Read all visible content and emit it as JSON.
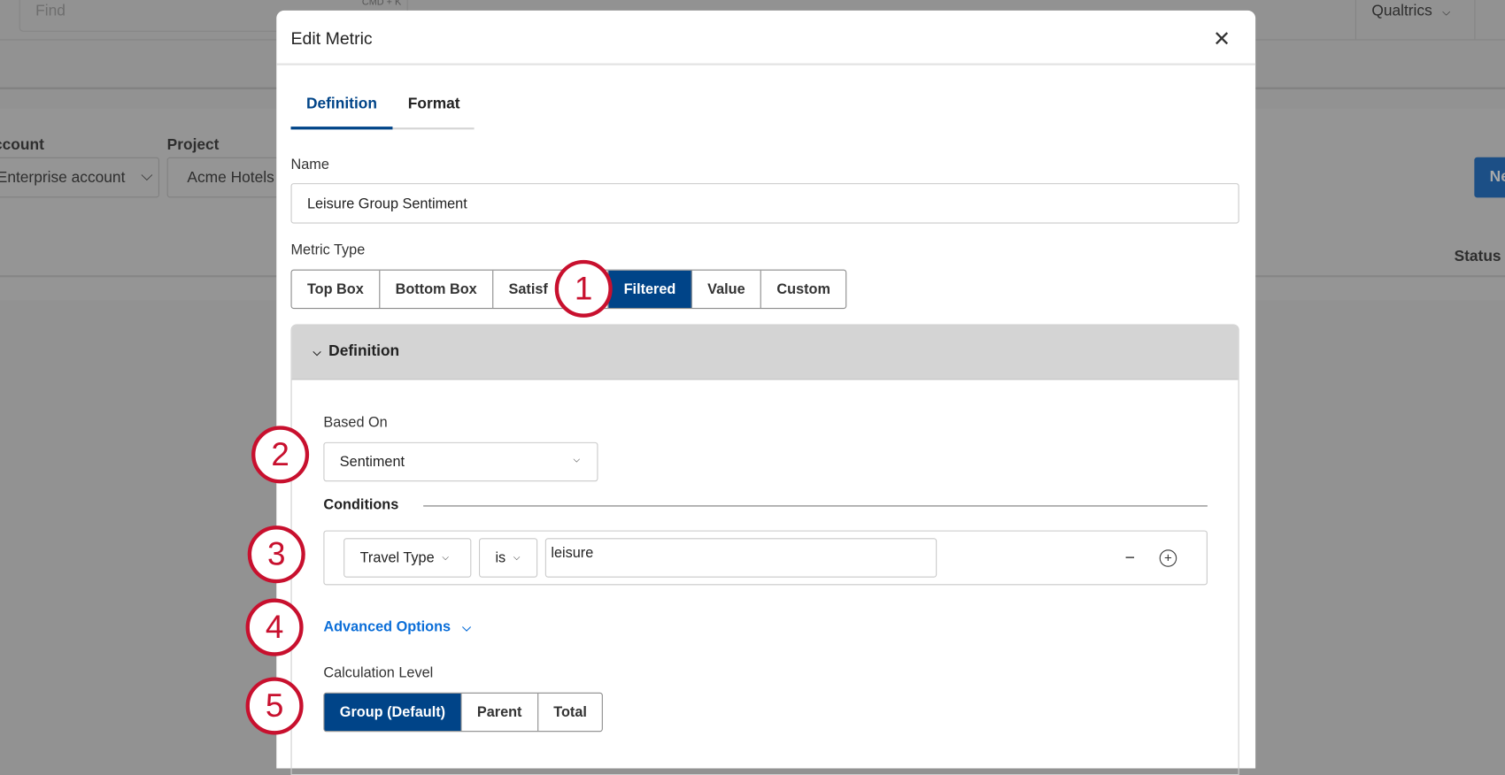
{
  "background": {
    "search_placeholder": "Find",
    "search_shortcut": "CMD + K",
    "org_menu": "Qualtrics",
    "account_label": "Account",
    "account_value": "Enterprise account",
    "project_label": "Project",
    "project_value": "Acme Hotels",
    "new_button": "New",
    "status_header": "Status"
  },
  "modal": {
    "title": "Edit Metric",
    "tabs": [
      {
        "label": "Definition",
        "active": true
      },
      {
        "label": "Format",
        "active": false
      }
    ],
    "name_label": "Name",
    "name_value": "Leisure Group Sentiment",
    "metric_type_label": "Metric Type",
    "metric_types_visible": [
      "Top Box",
      "Bottom Box",
      "Satisf",
      "Filtered",
      "Value",
      "Custom"
    ],
    "metric_type_selected": "Filtered",
    "section_title": "Definition",
    "based_on_label": "Based On",
    "based_on_value": "Sentiment",
    "conditions_label": "Conditions",
    "condition": {
      "field": "Travel Type",
      "operator": "is",
      "value": "leisure"
    },
    "advanced_options": "Advanced Options",
    "calc_level_label": "Calculation Level",
    "calc_levels": [
      "Group (Default)",
      "Parent",
      "Total"
    ],
    "calc_level_selected": "Group (Default)"
  },
  "callouts": [
    "1",
    "2",
    "3",
    "4",
    "5"
  ],
  "colors": {
    "accent": "#004488",
    "link": "#0b6ed8",
    "callout": "#c8102e",
    "overlay": "#929292"
  }
}
